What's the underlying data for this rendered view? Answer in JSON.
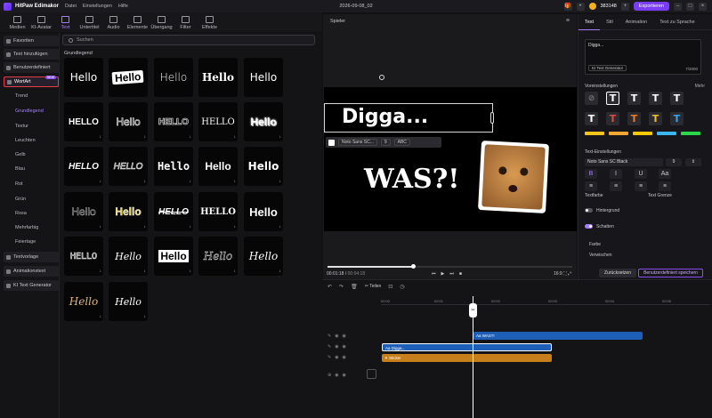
{
  "app": {
    "title": "HitPaw Edimakor",
    "menu": [
      "Datei",
      "Einstellungen",
      "Hilfe"
    ],
    "project_title": "2026-09-08_02",
    "coins": "383148",
    "export_label": "Exportieren"
  },
  "tooltabs": [
    {
      "label": "Medien",
      "icon": "media-icon"
    },
    {
      "label": "KI-Avatar",
      "icon": "avatar-icon"
    },
    {
      "label": "Text",
      "icon": "text-icon",
      "active": true
    },
    {
      "label": "Untertitel",
      "icon": "subtitle-icon"
    },
    {
      "label": "Audio",
      "icon": "audio-icon"
    },
    {
      "label": "Elemente",
      "icon": "elements-icon"
    },
    {
      "label": "Übergang",
      "icon": "transition-icon"
    },
    {
      "label": "Filter",
      "icon": "filter-icon"
    },
    {
      "label": "Effekte",
      "icon": "effects-icon"
    }
  ],
  "leftnav": {
    "groups": [
      "Favoriten",
      "Text hinzufügen",
      "Benutzerdefiniert",
      "WortArt"
    ],
    "wordart_badge": "NEW",
    "sub": [
      "Trend",
      "Grundlegend",
      "Textur",
      "Leuchten",
      "Gelb",
      "Blau",
      "Rot",
      "Grün",
      "Rosa",
      "Mehrfarbig",
      "Feiertage"
    ],
    "bottom": [
      "Textvorlage",
      "Animationstext",
      "KI Text Generator"
    ]
  },
  "library": {
    "search_placeholder": "Suchen",
    "section_title": "Grundlegend",
    "tile_text": "Hello",
    "outline_text": "HELLO"
  },
  "player": {
    "label": "Spieler",
    "text_main": "Digga...",
    "text_second": "WAS?!",
    "font_name": "Noto Sans SC...",
    "font_size": "9",
    "case_label": "ABC",
    "time_current": "00:01:18",
    "time_total": "00:04:18",
    "aspect": "16:9",
    "progress": 0.35
  },
  "rpanel": {
    "tabs": [
      "Text",
      "Stil",
      "Animation",
      "Text zu Sprache"
    ],
    "text_value": "Digga...",
    "ai_label": "KI Text Generator",
    "char_count": "7/2000",
    "presets_label": "Voreinstellungen",
    "more_label": "Mehr",
    "text_settings_label": "Text-Einstellungen",
    "font": "Noto Sans SC Black",
    "size_a": "9",
    "text_color_label": "Textfarbe",
    "text_border_label": "Text Grenze",
    "background_label": "Hintergrund",
    "shadow_label": "Schatten",
    "color_label": "Farbe",
    "blur_label": "Verwischen",
    "reset_label": "Zurücksetzen",
    "save_label": "Benutzerdefiniert speichern",
    "preset_colors": [
      "#ffffff",
      "#ffffff",
      "#ffffff",
      "#ffffff",
      "#ffffff",
      "#e24b3a",
      "#f07a22",
      "#f0c020",
      "#2da8f5",
      "#2dd44a",
      "#f5c51e",
      "#f0a830",
      "#f5c800",
      "#3ab6f5",
      "#2ad64a"
    ]
  },
  "timeline": {
    "split_label": "Teilen",
    "ruler": [
      "00:00",
      "00:01",
      "00:02",
      "00:03",
      "00:04",
      "00:05"
    ],
    "clip_was": "Aa WAS?!",
    "clip_digga": "Aa Digga...",
    "clip_sticker": "✦ Sticker"
  }
}
